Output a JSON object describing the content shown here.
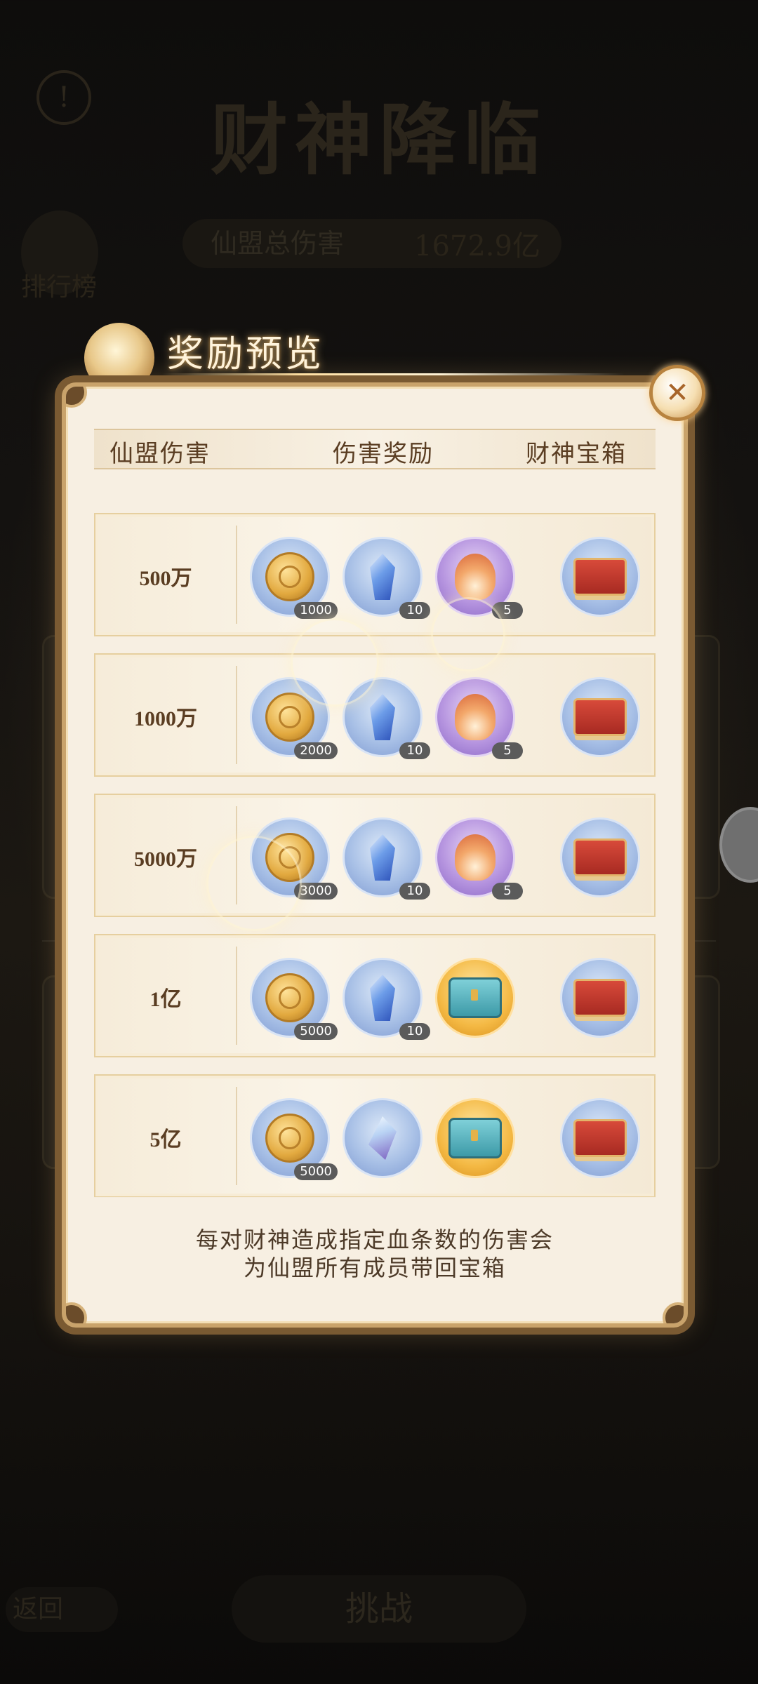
{
  "background": {
    "event_title": "财神降临",
    "ranking_label": "排行榜",
    "total_damage_label": "仙盟总伤害",
    "total_damage_value": "1672.9亿",
    "challenge_label": "挑战",
    "return_label": "返回"
  },
  "modal": {
    "title": "奖励预览",
    "close_icon": "close-icon",
    "headers": [
      "仙盟伤害",
      "伤害奖励",
      "财神宝箱"
    ],
    "rows": [
      {
        "label": "500万",
        "items": [
          {
            "icon": "coin",
            "count": "1000"
          },
          {
            "icon": "crystal",
            "count": "10"
          },
          {
            "icon": "lotus",
            "count": "5"
          }
        ],
        "box_icon": "red-treasure-box"
      },
      {
        "label": "1000万",
        "items": [
          {
            "icon": "coin",
            "count": "2000"
          },
          {
            "icon": "crystal",
            "count": "10"
          },
          {
            "icon": "lotus",
            "count": "5"
          }
        ],
        "box_icon": "red-treasure-box"
      },
      {
        "label": "5000万",
        "items": [
          {
            "icon": "coin",
            "count": "3000"
          },
          {
            "icon": "crystal",
            "count": "10"
          },
          {
            "icon": "lotus",
            "count": "5"
          }
        ],
        "box_icon": "red-treasure-box"
      },
      {
        "label": "1亿",
        "items": [
          {
            "icon": "coin",
            "count": "5000"
          },
          {
            "icon": "crystal",
            "count": "10"
          },
          {
            "icon": "chest",
            "count": ""
          }
        ],
        "box_icon": "red-treasure-box"
      },
      {
        "label": "5亿",
        "items": [
          {
            "icon": "coin",
            "count": "5000"
          },
          {
            "icon": "gem",
            "count": ""
          },
          {
            "icon": "chest",
            "count": ""
          }
        ],
        "box_icon": "red-treasure-box"
      }
    ],
    "footer_line1": "每对财神造成指定血条数的伤害会",
    "footer_line2": "为仙盟所有成员带回宝箱"
  },
  "colors": {
    "panel_bg": "#f7efe2",
    "frame_gold": "#c9a36b",
    "text_brown": "#5a3d22"
  }
}
